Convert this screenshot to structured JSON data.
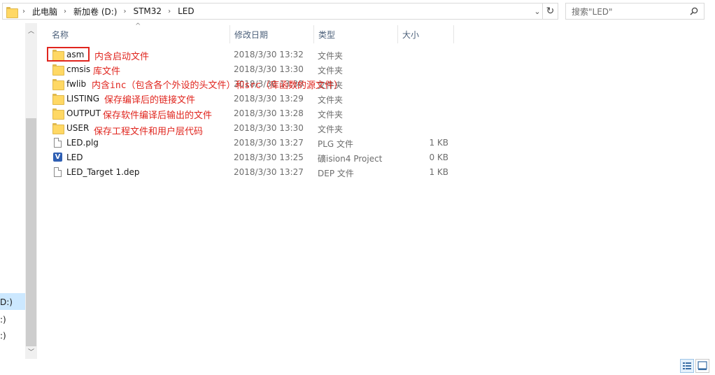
{
  "address": {
    "crumbs": [
      "此电脑",
      "新加卷 (D:)",
      "STM32",
      "LED"
    ]
  },
  "search": {
    "placeholder": "搜索\"LED\""
  },
  "columns": {
    "name": "名称",
    "date": "修改日期",
    "type": "类型",
    "size": "大小"
  },
  "nav": {
    "items": [
      "D:)",
      ":)",
      ":)"
    ]
  },
  "files": [
    {
      "name": "asm",
      "date": "2018/3/30 13:32",
      "type": "文件夹",
      "size": "",
      "kind": "folder"
    },
    {
      "name": "cmsis",
      "date": "2018/3/30 13:30",
      "type": "文件夹",
      "size": "",
      "kind": "folder"
    },
    {
      "name": "fwlib",
      "date": "2018/3/30 13:30",
      "type": "文件夹",
      "size": "",
      "kind": "folder"
    },
    {
      "name": "LISTING",
      "date": "2018/3/30 13:29",
      "type": "文件夹",
      "size": "",
      "kind": "folder"
    },
    {
      "name": "OUTPUT",
      "date": "2018/3/30 13:28",
      "type": "文件夹",
      "size": "",
      "kind": "folder"
    },
    {
      "name": "USER",
      "date": "2018/3/30 13:30",
      "type": "文件夹",
      "size": "",
      "kind": "folder"
    },
    {
      "name": "LED.plg",
      "date": "2018/3/30 13:27",
      "type": "PLG 文件",
      "size": "1 KB",
      "kind": "file"
    },
    {
      "name": "LED",
      "date": "2018/3/30 13:25",
      "type": "礦ision4 Project",
      "size": "0 KB",
      "kind": "uvision"
    },
    {
      "name": "LED_Target 1.dep",
      "date": "2018/3/30 13:27",
      "type": "DEP 文件",
      "size": "1 KB",
      "kind": "file"
    }
  ],
  "annotations": {
    "asm": "内含启动文件",
    "cmsis": "库文件",
    "fwlib": "内含inc（包含各个外设的头文件）和src（库函数的源文件）",
    "listing": "保存编译后的链接文件",
    "output": "保存软件编译后输出的文件",
    "user": "保存工程文件和用户层代码"
  },
  "colors": {
    "annotation": "#e0251e",
    "folder": "#ffd864",
    "selection": "#cce8ff"
  }
}
